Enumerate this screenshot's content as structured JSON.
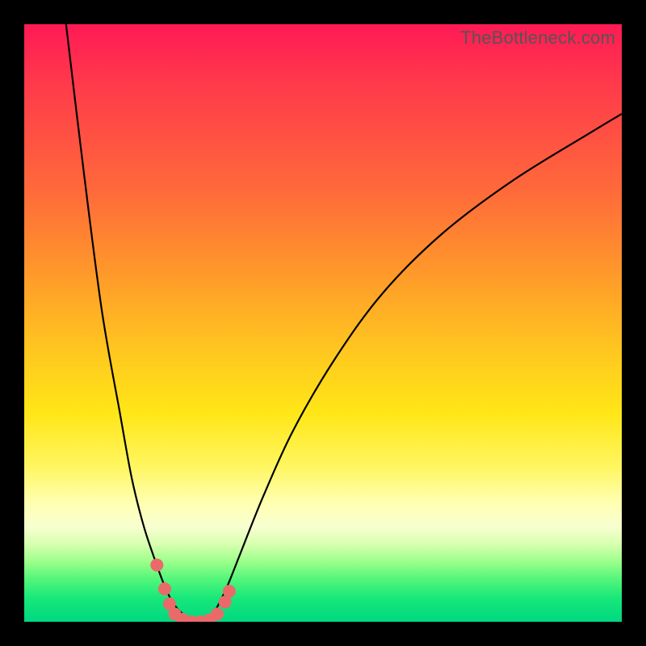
{
  "watermark": "TheBottleneck.com",
  "chart_data": {
    "type": "line",
    "title": "",
    "xlabel": "",
    "ylabel": "",
    "xlim": [
      0,
      100
    ],
    "ylim": [
      0,
      100
    ],
    "grid": false,
    "legend": false,
    "background": "rainbow-vertical-gradient",
    "series": [
      {
        "name": "left-curve",
        "x": [
          7,
          10,
          13,
          16,
          18,
          20,
          22,
          23.5,
          25,
          27,
          30
        ],
        "values": [
          100,
          75,
          52,
          35,
          24,
          16,
          10,
          6,
          3,
          1,
          0
        ]
      },
      {
        "name": "right-curve",
        "x": [
          30,
          32,
          34,
          36,
          40,
          45,
          52,
          60,
          70,
          82,
          95,
          100
        ],
        "values": [
          0,
          2,
          6,
          11,
          21,
          32,
          44,
          55,
          65,
          74,
          82,
          85
        ]
      }
    ],
    "markers": [
      {
        "x": 22.2,
        "y": 9.5
      },
      {
        "x": 23.5,
        "y": 5.5
      },
      {
        "x": 24.3,
        "y": 3.0
      },
      {
        "x": 25.2,
        "y": 1.3
      },
      {
        "x": 26.5,
        "y": 0.4
      },
      {
        "x": 28.0,
        "y": 0.0
      },
      {
        "x": 29.5,
        "y": 0.0
      },
      {
        "x": 31.0,
        "y": 0.3
      },
      {
        "x": 32.3,
        "y": 1.3
      },
      {
        "x": 33.6,
        "y": 3.3
      },
      {
        "x": 34.3,
        "y": 5.1
      }
    ],
    "marker_color": "#ea6a6a",
    "marker_radius_px": 8
  },
  "colors": {
    "black": "#000000",
    "curve": "#000000",
    "marker": "#ea6a6a",
    "watermark": "#555555"
  }
}
